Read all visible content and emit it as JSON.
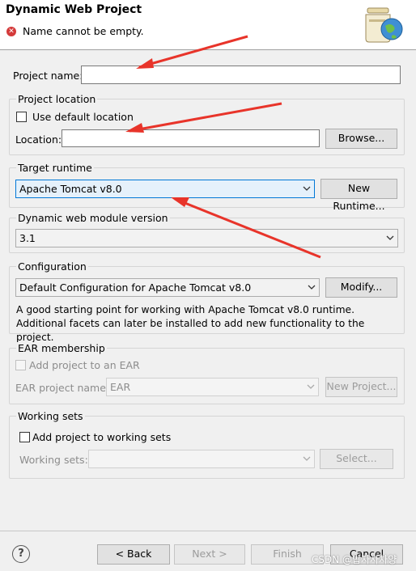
{
  "window": {
    "title": "Dynamic Web Project"
  },
  "message": {
    "text": "Name cannot be empty.",
    "icon": "error-icon",
    "color": "#d43a3a"
  },
  "project_name": {
    "label": "Project name:",
    "value": ""
  },
  "project_location": {
    "title": "Project location",
    "use_default_label": "Use default location",
    "use_default_checked": false,
    "location_label": "Location:",
    "location_value": "",
    "browse_label": "Browse..."
  },
  "target_runtime": {
    "title": "Target runtime",
    "selected": "Apache Tomcat v8.0",
    "new_runtime_label": "New Runtime..."
  },
  "module_version": {
    "title": "Dynamic web module version",
    "selected": "3.1"
  },
  "configuration": {
    "title": "Configuration",
    "selected": "Default Configuration for Apache Tomcat v8.0",
    "modify_label": "Modify...",
    "description": "A good starting point for working with Apache Tomcat v8.0 runtime. Additional facets can later be installed to add new functionality to the project."
  },
  "ear": {
    "title": "EAR membership",
    "add_label": "Add project to an EAR",
    "add_checked": false,
    "name_label": "EAR project name:",
    "name_value": "EAR",
    "new_project_label": "New Project..."
  },
  "working_sets": {
    "title": "Working sets",
    "add_label": "Add project to working sets",
    "add_checked": false,
    "sets_label": "Working sets:",
    "sets_value": "",
    "select_label": "Select..."
  },
  "footer": {
    "back_label": "< Back",
    "next_label": "Next >",
    "finish_label": "Finish",
    "cancel_label": "Cancel"
  },
  "watermark": "CSDN @밥자사차양",
  "accent_color": "#0078d7",
  "annotation_color": "#e8342a"
}
